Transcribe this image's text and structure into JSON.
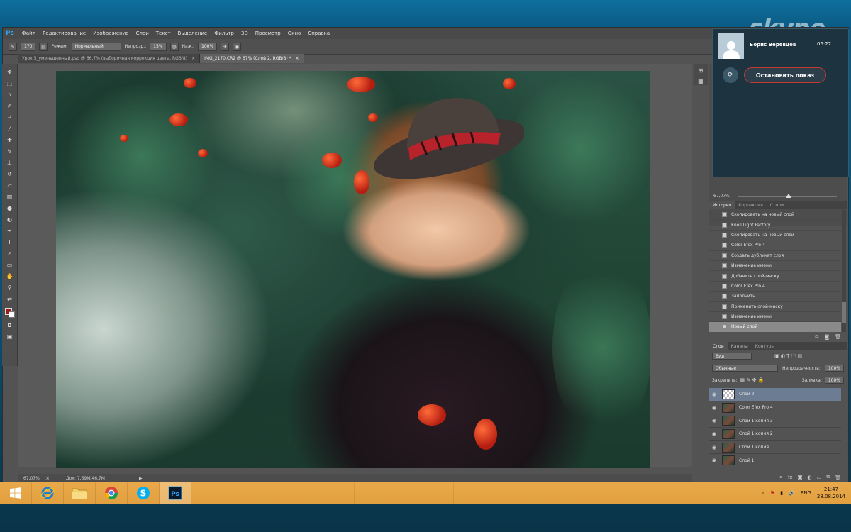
{
  "photoshop": {
    "logo": "Ps",
    "menu": [
      "Файл",
      "Редактирование",
      "Изображение",
      "Слои",
      "Текст",
      "Выделение",
      "Фильтр",
      "3D",
      "Просмотр",
      "Окно",
      "Справка"
    ],
    "options": {
      "brush_size": "170",
      "mode_label": "Режим:",
      "mode_value": "Нормальный",
      "opacity_label": "Непрозр.:",
      "opacity_value": "15%",
      "flow_label": "Наж.:",
      "flow_value": "100%"
    },
    "tabs": [
      {
        "label": "Урок 5_уменьшенный.psd @ 66,7% (выборочная коррекция цвета, RGB/8)",
        "close": "×"
      },
      {
        "label": "IMG_2170.CR2 @ 67% (Слой 2, RGB/8) *",
        "close": "×"
      }
    ],
    "status": {
      "zoom": "67,07%",
      "doc": "Док: 7,69М/46,7М"
    },
    "navigator": {
      "zoom": "67,07%"
    },
    "history_tabs": [
      "История",
      "Коррекция",
      "Стили"
    ],
    "history": [
      "Скопировать на новый слой",
      "Knoll Light Factory",
      "Скопировать на новый слой",
      "Color Efex Pro 4",
      "Создать дубликат слоя",
      "Изменение имени",
      "Добавить слой-маску",
      "Color Efex Pro 4",
      "Заполнить",
      "Применить слой-маску",
      "Изменение имени",
      "Новый слой"
    ],
    "layers_tabs": [
      "Слои",
      "Каналы",
      "Контуры"
    ],
    "layers_panel": {
      "kind": "Вид",
      "blend": "Обычные",
      "opacity_label": "Непрозрачность:",
      "opacity_value": "100%",
      "lock_label": "Закрепить:",
      "fill_label": "Заливка:",
      "fill_value": "100%"
    },
    "layers": [
      "Слой 2",
      "Color Efex Pro 4",
      "Слой 1 копия 3",
      "Слой 1 копия 2",
      "Слой 1 копия",
      "Слой 1"
    ]
  },
  "skype": {
    "logo": "skype",
    "caller": "Борис Веревцов",
    "time": "06:22",
    "stop_button": "Остановить показ"
  },
  "taskbar": {
    "lang": "ENG",
    "time": "21:47",
    "date": "28.08.2014"
  }
}
